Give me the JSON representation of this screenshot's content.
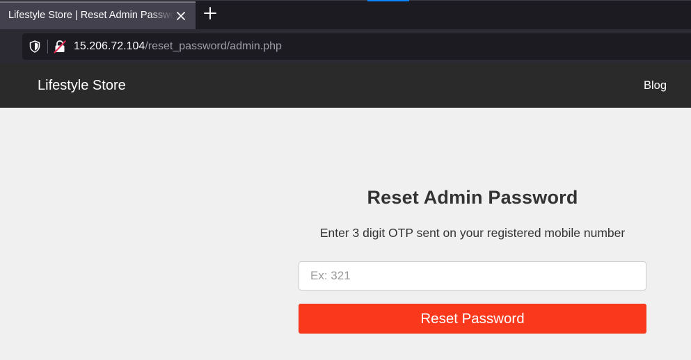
{
  "browser": {
    "tab": {
      "title": "Lifestyle Store | Reset Admin Password",
      "close_icon": "close-icon"
    },
    "new_tab_icon": "plus-icon",
    "url": {
      "host": "15.206.72.104",
      "path": "/reset_password/admin.php"
    },
    "security_icons": [
      "shield-icon",
      "insecure-lock-icon"
    ],
    "colors": {
      "tab_active": "#42414d",
      "tabbar": "#1c1b22",
      "urlbar": "#1c1b22"
    }
  },
  "navbar": {
    "brand": "Lifestyle Store",
    "links": [
      {
        "label": "Blog"
      }
    ],
    "background": "#2a2a2a"
  },
  "reset_form": {
    "title": "Reset Admin Password",
    "instructions": "Enter 3 digit OTP sent on your registered mobile number",
    "otp_field": {
      "value": "",
      "placeholder": "Ex: 321"
    },
    "submit_label": "Reset Password",
    "accent_color": "#fa391c"
  }
}
